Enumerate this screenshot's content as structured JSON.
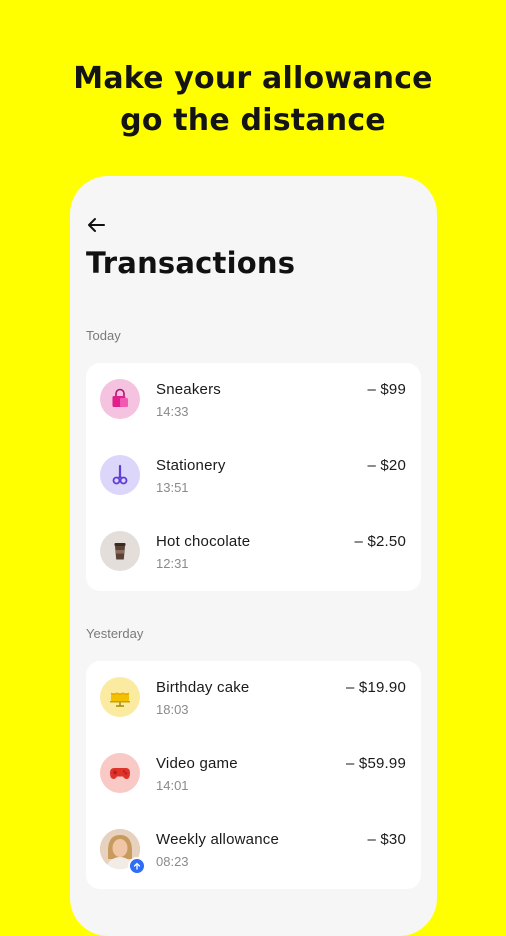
{
  "headline": {
    "line1": "Make your allowance",
    "line2": "go the distance"
  },
  "screen": {
    "title": "Transactions"
  },
  "sections": [
    {
      "label": "Today",
      "items": [
        {
          "name": "Sneakers",
          "time": "14:33",
          "amount": "– $99",
          "icon": "shopping-bag-icon",
          "color": "#F5C2E0"
        },
        {
          "name": "Stationery",
          "time": "13:51",
          "amount": "– $20",
          "icon": "scissors-icon",
          "color": "#DCD6FA"
        },
        {
          "name": "Hot chocolate",
          "time": "12:31",
          "amount": "– $2.50",
          "icon": "coffee-cup-icon",
          "color": "#E4DEDA"
        }
      ]
    },
    {
      "label": "Yesterday",
      "items": [
        {
          "name": "Birthday cake",
          "time": "18:03",
          "amount": "– $19.90",
          "icon": "cake-icon",
          "color": "#FBEBA0"
        },
        {
          "name": "Video game",
          "time": "14:01",
          "amount": "– $59.99",
          "icon": "gamepad-icon",
          "color": "#F9C9C6"
        },
        {
          "name": "Weekly allowance",
          "time": "08:23",
          "amount": "– $30",
          "icon": "parent-photo-icon",
          "color": "#D9B79A"
        }
      ]
    }
  ],
  "colors": {
    "background": "#FFFF00",
    "card": "#FFFFFF",
    "phone": "#F6F6F6",
    "badge": "#2F6DF6"
  }
}
